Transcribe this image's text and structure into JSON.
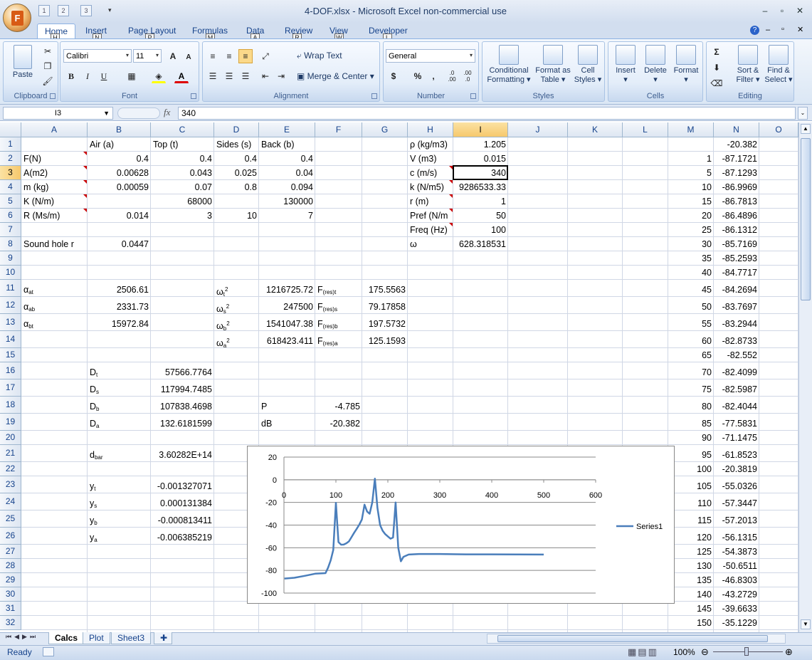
{
  "window": {
    "title": "4-DOF.xlsx - Microsoft Excel non-commercial use",
    "qat_keytips": [
      "1",
      "2",
      "3"
    ]
  },
  "ribbon": {
    "tabs": [
      {
        "label": "Home",
        "keytip": "H"
      },
      {
        "label": "Insert",
        "keytip": "N"
      },
      {
        "label": "Page Layout",
        "keytip": "P"
      },
      {
        "label": "Formulas",
        "keytip": "M"
      },
      {
        "label": "Data",
        "keytip": "A"
      },
      {
        "label": "Review",
        "keytip": "R"
      },
      {
        "label": "View",
        "keytip": "W"
      },
      {
        "label": "Developer",
        "keytip": "L"
      }
    ],
    "clipboard": {
      "label": "Clipboard",
      "paste": "Paste"
    },
    "font": {
      "label": "Font",
      "name": "Calibri",
      "size": "11",
      "bold": "B",
      "italic": "I",
      "underline": "U",
      "grow": "A",
      "shrink": "A"
    },
    "alignment": {
      "label": "Alignment",
      "wrap": "Wrap Text",
      "merge": "Merge & Center"
    },
    "number": {
      "label": "Number",
      "format": "General",
      "currency": "$",
      "percent": "%",
      "comma": ",",
      "inc_dec": ".0 .00",
      "dec_dec": ".00 .0"
    },
    "styles": {
      "label": "Styles",
      "conditional": "Conditional Formatting",
      "format_table": "Format as Table",
      "cell_styles": "Cell Styles"
    },
    "cells": {
      "label": "Cells",
      "insert": "Insert",
      "delete": "Delete",
      "format": "Format"
    },
    "editing": {
      "label": "Editing",
      "sort": "Sort & Filter",
      "find": "Find & Select",
      "sum": "Σ"
    }
  },
  "formula_bar": {
    "name_box": "I3",
    "fx": "fx",
    "value": "340"
  },
  "columns": [
    "A",
    "B",
    "C",
    "D",
    "E",
    "F",
    "G",
    "H",
    "I",
    "J",
    "K",
    "L",
    "M",
    "N",
    "O"
  ],
  "rows": [
    "1",
    "2",
    "3",
    "4",
    "5",
    "6",
    "7",
    "8",
    "9",
    "10",
    "11",
    "12",
    "13",
    "14",
    "15",
    "16",
    "17",
    "18",
    "19",
    "20",
    "21",
    "22",
    "23",
    "24",
    "25",
    "26",
    "27",
    "28",
    "29",
    "30",
    "31",
    "32"
  ],
  "cells": {
    "B1": "Air (a)",
    "C1": "Top (t)",
    "D1": "Sides (s)",
    "E1": "Back (b)",
    "A2": "F(N)",
    "B2": "0.4",
    "C2": "0.4",
    "D2": "0.4",
    "E2": "0.4",
    "A3": "A(m2)",
    "B3": "0.00628",
    "C3": "0.043",
    "D3": "0.025",
    "E3": "0.04",
    "A4": "m (kg)",
    "B4": "0.00059",
    "C4": "0.07",
    "D4": "0.8",
    "E4": "0.094",
    "A5": "K (N/m)",
    "C5": "68000",
    "E5": "130000",
    "A6": "R (Ms/m)",
    "B6": "0.014",
    "C6": "3",
    "D6": "10",
    "E6": "7",
    "A8": "Sound hole r",
    "B8": "0.0447",
    "A11": "α",
    "A11s": "at",
    "B11": "2506.61",
    "A12": "α",
    "A12s": "ab",
    "B12": "2331.73",
    "A13": "α",
    "A13s": "bt",
    "B13": "15972.84",
    "D11": "ω",
    "D11s": "t",
    "D11p": "2",
    "E11": "1216725.72",
    "F11": "F",
    "F11s": "(res)t",
    "G11": "175.5563",
    "D12": "ω",
    "D12s": "s",
    "D12p": "2",
    "E12": "247500",
    "F12": "F",
    "F12s": "(res)s",
    "G12": "79.17858",
    "D13": "ω",
    "D13s": "b",
    "D13p": "2",
    "E13": "1541047.38",
    "F13": "F",
    "F13s": "(res)b",
    "G13": "197.5732",
    "D14": "ω",
    "D14s": "a",
    "D14p": "2",
    "E14": "618423.411",
    "F14": "F",
    "F14s": "(res)a",
    "G14": "125.1593",
    "B16": "D",
    "B16s": "t",
    "C16": "57566.7764",
    "B17": "D",
    "B17s": "s",
    "C17": "117994.7485",
    "B18": "D",
    "B18s": "b",
    "C18": "107838.4698",
    "E18": "P",
    "F18": "-4.785",
    "B19": "D",
    "B19s": "a",
    "C19": "132.6181599",
    "E19": "dB",
    "F19": "-20.382",
    "B21": "d",
    "B21s": "bar",
    "C21": "3.60282E+14",
    "B23": "y",
    "B23s": "t",
    "C23": "-0.001327071",
    "B24": "y",
    "B24s": "s",
    "C24": "0.000131384",
    "B25": "y",
    "B25s": "b",
    "C25": "-0.000813411",
    "B26": "y",
    "B26s": "a",
    "C26": "-0.006385219",
    "H1": "ρ (kg/m3)",
    "I1": "1.205",
    "H2": "V (m3)",
    "I2": "0.015",
    "H3": "c (m/s)",
    "I3": "340",
    "H4": "k (N/m5)",
    "I4": "9286533.33",
    "H5": "r (m)",
    "I5": "1",
    "H6": "Pref (N/m",
    "I6": "50",
    "H7": "Freq (Hz)",
    "I7": "100",
    "H8": "ω",
    "I8": "628.318531"
  },
  "col_m": [
    "",
    "1",
    "5",
    "10",
    "15",
    "20",
    "25",
    "30",
    "35",
    "40",
    "45",
    "50",
    "55",
    "60",
    "65",
    "70",
    "75",
    "80",
    "85",
    "90",
    "95",
    "100",
    "105",
    "110",
    "115",
    "120",
    "125",
    "130",
    "135",
    "140",
    "145",
    "150"
  ],
  "col_n": [
    "-20.382",
    "-87.1721",
    "-87.1293",
    "-86.9969",
    "-86.7813",
    "-86.4896",
    "-86.1312",
    "-85.7169",
    "-85.2593",
    "-84.7717",
    "-84.2694",
    "-83.7697",
    "-83.2944",
    "-82.8733",
    "-82.552",
    "-82.4099",
    "-82.5987",
    "-82.4044",
    "-77.5831",
    "-71.1475",
    "-61.8523",
    "-20.3819",
    "-55.0326",
    "-57.3447",
    "-57.2013",
    "-56.1315",
    "-54.3873",
    "-50.6511",
    "-46.8303",
    "-43.2729",
    "-39.6633",
    "-35.1229"
  ],
  "chart_data": {
    "type": "line",
    "x_ticks": [
      "0",
      "100",
      "200",
      "300",
      "400",
      "500",
      "600"
    ],
    "y_ticks": [
      "20",
      "0",
      "-20",
      "-40",
      "-60",
      "-80",
      "-100"
    ],
    "xlim": [
      0,
      600
    ],
    "ylim": [
      -100,
      20
    ],
    "grid": true,
    "legend": "right",
    "series": [
      {
        "name": "Series1",
        "color": "#4a7ebb",
        "x": [
          1,
          20,
          40,
          60,
          80,
          85,
          90,
          95,
          100,
          105,
          110,
          115,
          120,
          125,
          130,
          135,
          140,
          145,
          150,
          155,
          160,
          165,
          170,
          175,
          180,
          185,
          190,
          195,
          200,
          205,
          210,
          215,
          220,
          225,
          230,
          240,
          260,
          300,
          350,
          400,
          450,
          500
        ],
        "y": [
          -87.2,
          -86.5,
          -84.8,
          -82.9,
          -82.4,
          -77.6,
          -71.1,
          -61.9,
          -20.4,
          -55.0,
          -57.3,
          -57.2,
          -56.1,
          -54.4,
          -50.7,
          -46.8,
          -43.3,
          -39.7,
          -35.1,
          -22,
          -28,
          -30,
          -20,
          1,
          -25,
          -40,
          -45,
          -48,
          -50,
          -52,
          -51,
          -20,
          -60,
          -72,
          -68,
          -66,
          -65.5,
          -65.5,
          -65.8,
          -65.8,
          -65.9,
          -66
        ]
      }
    ]
  },
  "sheets": [
    "Calcs",
    "Plot",
    "Sheet3"
  ],
  "status": {
    "ready": "Ready",
    "zoom": "100%"
  }
}
